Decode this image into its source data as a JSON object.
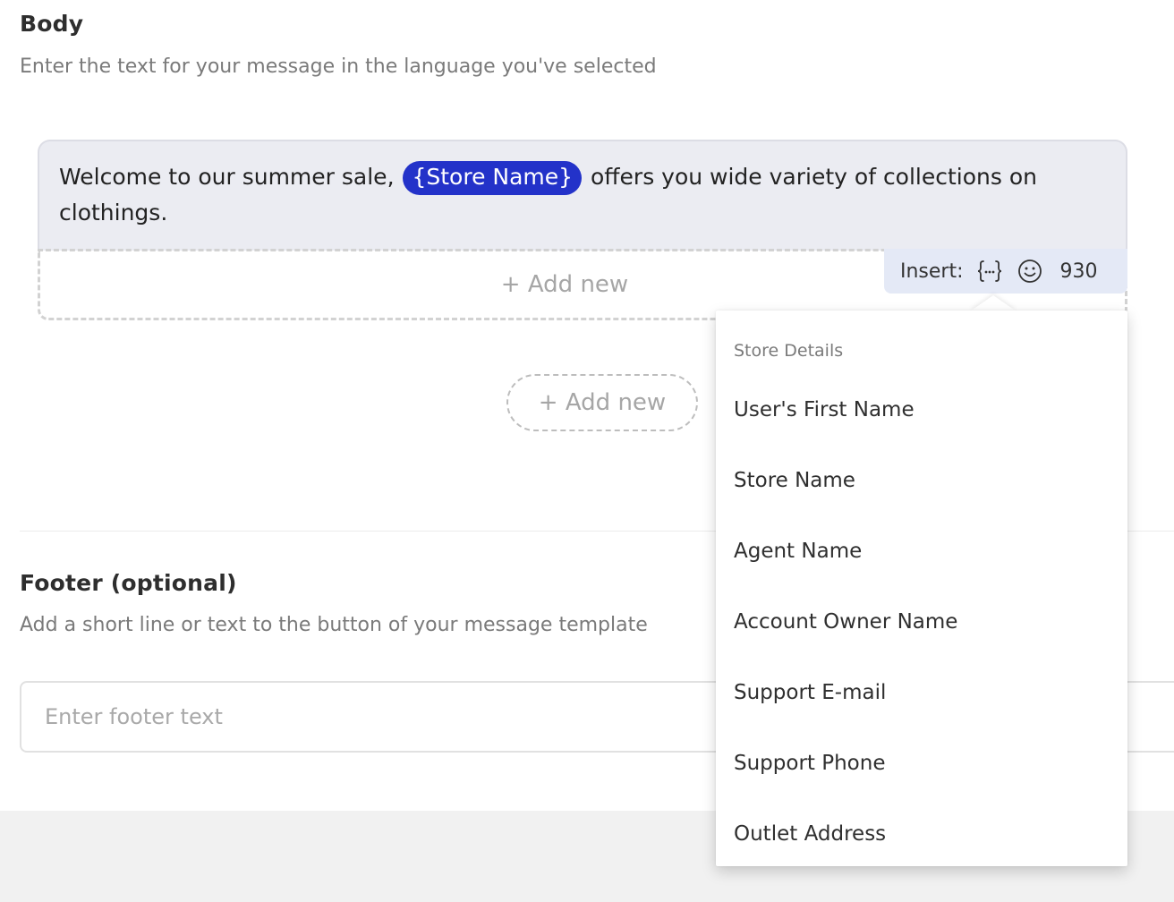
{
  "body_section": {
    "title": "Body",
    "subtitle": "Enter the text for your message in the language you've selected",
    "message": {
      "text_before": "Welcome to our summer sale, ",
      "variable": "{Store Name}",
      "text_after": " offers you wide variety of collections on clothings."
    },
    "add_new_strip": "+ Add new",
    "insert": {
      "label": "Insert:",
      "variable_icon": "curly-braces-icon",
      "emoji_icon": "smiley-icon",
      "char_count": "930"
    },
    "add_new_button": "+ Add new"
  },
  "footer_section": {
    "title": "Footer (optional)",
    "subtitle": "Add a short line or text to the button of your message template",
    "input_placeholder": "Enter footer text",
    "input_value": ""
  },
  "variables_dropdown": {
    "header": "Store Details",
    "items": [
      "User's First Name",
      "Store Name",
      "Agent Name",
      "Account Owner Name",
      "Support E-mail",
      "Support Phone",
      "Outlet Address"
    ]
  },
  "colors": {
    "variable_chip": "#2332c9",
    "editor_bg": "#ebecf2",
    "insert_bar_bg": "#e4e9f6"
  }
}
